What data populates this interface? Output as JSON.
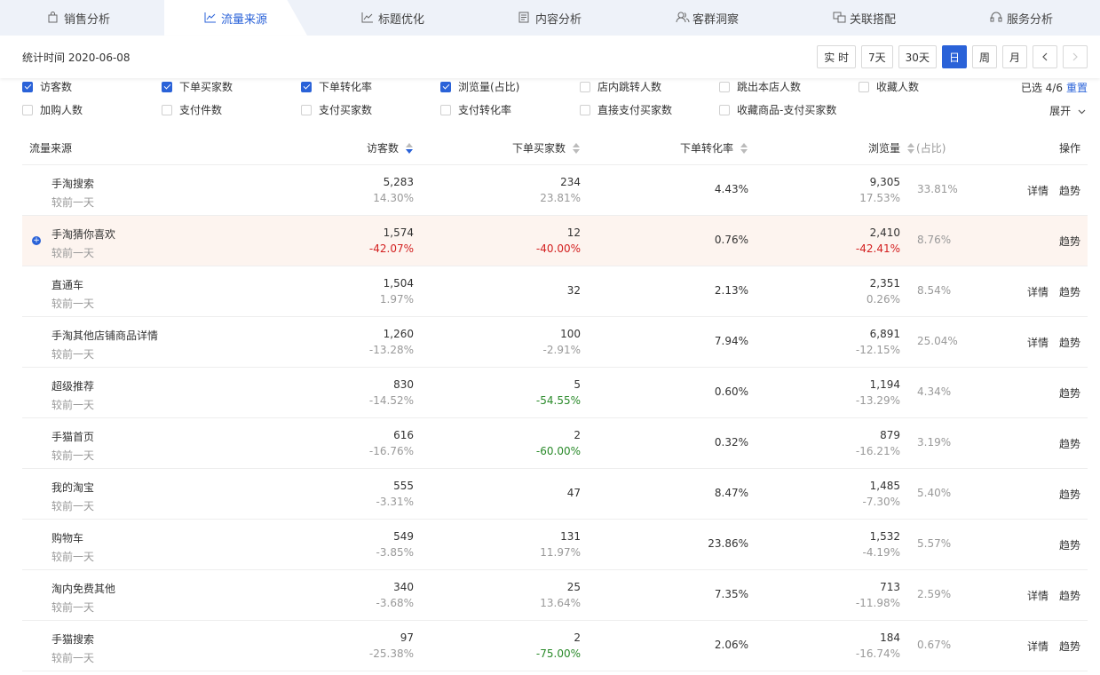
{
  "tabs": [
    {
      "label": "销售分析",
      "icon": "shopping-bag-icon"
    },
    {
      "label": "流量来源",
      "icon": "trend-line-icon",
      "active": true
    },
    {
      "label": "标题优化",
      "icon": "line-chart-icon"
    },
    {
      "label": "内容分析",
      "icon": "document-icon"
    },
    {
      "label": "客群洞察",
      "icon": "users-icon"
    },
    {
      "label": "关联搭配",
      "icon": "link-icon"
    },
    {
      "label": "服务分析",
      "icon": "headset-icon"
    }
  ],
  "stat": {
    "time_label": "统计时间 2020-06-08",
    "periods": [
      "实 时",
      "7天",
      "30天",
      "日",
      "周",
      "月"
    ],
    "active_period": "日"
  },
  "metrics": {
    "row1": [
      {
        "label": "访客数",
        "checked": true
      },
      {
        "label": "下单买家数",
        "checked": true
      },
      {
        "label": "下单转化率",
        "checked": true
      },
      {
        "label": "浏览量(占比)",
        "checked": true
      },
      {
        "label": "店内跳转人数",
        "checked": false
      },
      {
        "label": "跳出本店人数",
        "checked": false
      },
      {
        "label": "收藏人数",
        "checked": false
      }
    ],
    "row2": [
      {
        "label": "加购人数",
        "checked": false
      },
      {
        "label": "支付件数",
        "checked": false
      },
      {
        "label": "支付买家数",
        "checked": false
      },
      {
        "label": "支付转化率",
        "checked": false
      },
      {
        "label": "直接支付买家数",
        "checked": false
      },
      {
        "label": "收藏商品-支付买家数",
        "checked": false
      }
    ],
    "selected_text": "已选 4/6",
    "reset_label": "重置",
    "expand_label": "展开"
  },
  "table": {
    "headers": {
      "source": "流量来源",
      "visitors": "访客数",
      "buyers": "下单买家数",
      "conversion": "下单转化率",
      "pageviews": "浏览量",
      "share": "(占比)",
      "ops": "操作"
    },
    "compare_label": "较前一天",
    "detail_label": "详情",
    "trend_label": "趋势",
    "rows": [
      {
        "name": "手淘搜索",
        "visitors": "5,283",
        "visitors_delta": "14.30%",
        "vd": "n",
        "buyers": "234",
        "buyers_delta": "23.81%",
        "bd": "n",
        "conv": "4.43%",
        "pv": "9,305",
        "pv_delta": "17.53%",
        "pd": "n",
        "share": "33.81%",
        "detail": true,
        "hl": false
      },
      {
        "name": "手淘猜你喜欢",
        "visitors": "1,574",
        "visitors_delta": "-42.07%",
        "vd": "up",
        "buyers": "12",
        "buyers_delta": "-40.00%",
        "bd": "up",
        "conv": "0.76%",
        "pv": "2,410",
        "pv_delta": "-42.41%",
        "pd": "up",
        "share": "8.76%",
        "detail": false,
        "hl": true
      },
      {
        "name": "直通车",
        "visitors": "1,504",
        "visitors_delta": "1.97%",
        "vd": "n",
        "buyers": "32",
        "buyers_delta": "",
        "bd": "n",
        "conv": "2.13%",
        "pv": "2,351",
        "pv_delta": "0.26%",
        "pd": "n",
        "share": "8.54%",
        "detail": true,
        "hl": false
      },
      {
        "name": "手淘其他店铺商品详情",
        "visitors": "1,260",
        "visitors_delta": "-13.28%",
        "vd": "n",
        "buyers": "100",
        "buyers_delta": "-2.91%",
        "bd": "n",
        "conv": "7.94%",
        "pv": "6,891",
        "pv_delta": "-12.15%",
        "pd": "n",
        "share": "25.04%",
        "detail": true,
        "hl": false
      },
      {
        "name": "超级推荐",
        "visitors": "830",
        "visitors_delta": "-14.52%",
        "vd": "n",
        "buyers": "5",
        "buyers_delta": "-54.55%",
        "bd": "down",
        "conv": "0.60%",
        "pv": "1,194",
        "pv_delta": "-13.29%",
        "pd": "n",
        "share": "4.34%",
        "detail": false,
        "hl": false
      },
      {
        "name": "手猫首页",
        "visitors": "616",
        "visitors_delta": "-16.76%",
        "vd": "n",
        "buyers": "2",
        "buyers_delta": "-60.00%",
        "bd": "down",
        "conv": "0.32%",
        "pv": "879",
        "pv_delta": "-16.21%",
        "pd": "n",
        "share": "3.19%",
        "detail": false,
        "hl": false
      },
      {
        "name": "我的淘宝",
        "visitors": "555",
        "visitors_delta": "-3.31%",
        "vd": "n",
        "buyers": "47",
        "buyers_delta": "",
        "bd": "n",
        "conv": "8.47%",
        "pv": "1,485",
        "pv_delta": "-7.30%",
        "pd": "n",
        "share": "5.40%",
        "detail": false,
        "hl": false
      },
      {
        "name": "购物车",
        "visitors": "549",
        "visitors_delta": "-3.85%",
        "vd": "n",
        "buyers": "131",
        "buyers_delta": "11.97%",
        "bd": "n",
        "conv": "23.86%",
        "pv": "1,532",
        "pv_delta": "-4.19%",
        "pd": "n",
        "share": "5.57%",
        "detail": false,
        "hl": false
      },
      {
        "name": "淘内免费其他",
        "visitors": "340",
        "visitors_delta": "-3.68%",
        "vd": "n",
        "buyers": "25",
        "buyers_delta": "13.64%",
        "bd": "n",
        "conv": "7.35%",
        "pv": "713",
        "pv_delta": "-11.98%",
        "pd": "n",
        "share": "2.59%",
        "detail": true,
        "hl": false
      },
      {
        "name": "手猫搜索",
        "visitors": "97",
        "visitors_delta": "-25.38%",
        "vd": "n",
        "buyers": "2",
        "buyers_delta": "-75.00%",
        "bd": "down",
        "conv": "2.06%",
        "pv": "184",
        "pv_delta": "-16.74%",
        "pd": "n",
        "share": "0.67%",
        "detail": true,
        "hl": false
      }
    ]
  },
  "colors": {
    "accent": "#2a62d8",
    "up": "#d32020",
    "down": "#2a8a2a",
    "highlight": "#fdf4ef"
  }
}
